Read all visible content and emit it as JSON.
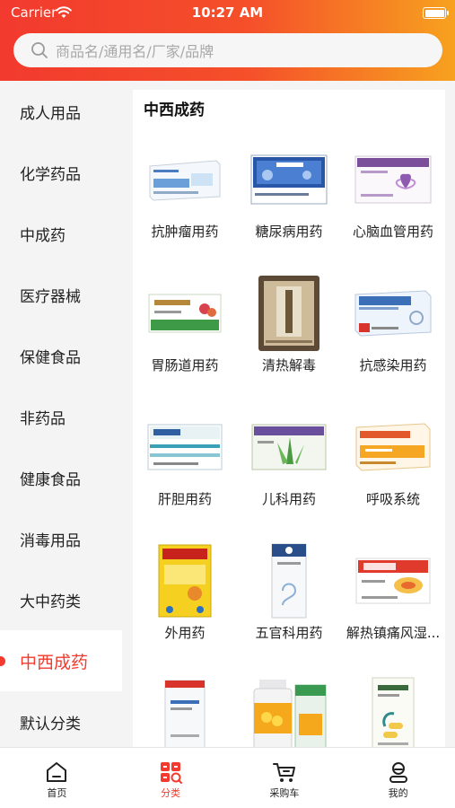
{
  "status_bar": {
    "carrier": "Carrier",
    "time": "10:27 AM"
  },
  "search": {
    "placeholder": "商品名/通用名/厂家/品牌"
  },
  "sidebar": {
    "items": [
      {
        "label": "成人用品",
        "active": false
      },
      {
        "label": "化学药品",
        "active": false
      },
      {
        "label": "中成药",
        "active": false
      },
      {
        "label": "医疗器械",
        "active": false
      },
      {
        "label": "保健食品",
        "active": false
      },
      {
        "label": "非药品",
        "active": false
      },
      {
        "label": "健康食品",
        "active": false
      },
      {
        "label": "消毒用品",
        "active": false
      },
      {
        "label": "大中药类",
        "active": false
      },
      {
        "label": "中西成药",
        "active": true
      },
      {
        "label": "默认分类",
        "active": false
      }
    ]
  },
  "main": {
    "section_title": "中西成药",
    "categories": [
      {
        "label": "抗肿瘤用药",
        "icon": "tumor-drug-box-icon"
      },
      {
        "label": "糖尿病用药",
        "icon": "diabetes-drug-box-icon"
      },
      {
        "label": "心脑血管用药",
        "icon": "cardio-drug-box-icon"
      },
      {
        "label": "胃肠道用药",
        "icon": "gastro-drug-box-icon"
      },
      {
        "label": "清热解毒",
        "icon": "detox-granule-bag-icon"
      },
      {
        "label": "抗感染用药",
        "icon": "anti-infection-drug-box-icon"
      },
      {
        "label": "肝胆用药",
        "icon": "liver-drug-box-icon"
      },
      {
        "label": "儿科用药",
        "icon": "pediatric-drug-box-icon"
      },
      {
        "label": "呼吸系统",
        "icon": "respiratory-granule-box-icon"
      },
      {
        "label": "外用药",
        "icon": "plaster-box-icon"
      },
      {
        "label": "五官科用药",
        "icon": "ent-drug-box-icon"
      },
      {
        "label": "解热镇痛风湿...",
        "icon": "analgesic-drug-box-icon"
      },
      {
        "label": "",
        "icon": "tablet-box-icon"
      },
      {
        "label": "",
        "icon": "pill-bottle-icon"
      },
      {
        "label": "",
        "icon": "capsule-box-icon"
      }
    ]
  },
  "tabbar": {
    "tabs": [
      {
        "label": "首页",
        "icon": "home-icon",
        "active": false
      },
      {
        "label": "分类",
        "icon": "category-icon",
        "active": true
      },
      {
        "label": "采购车",
        "icon": "cart-icon",
        "active": false
      },
      {
        "label": "我的",
        "icon": "profile-icon",
        "active": false
      }
    ]
  },
  "colors": {
    "accent": "#f23a2e",
    "gradient_end": "#f7a21f"
  }
}
